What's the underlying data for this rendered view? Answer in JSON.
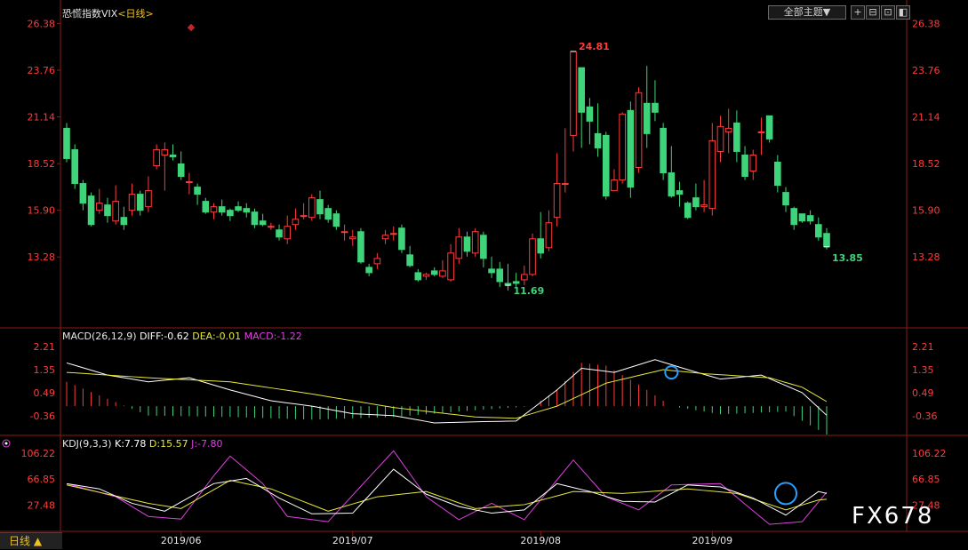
{
  "header": {
    "title": "恐慌指数VIX",
    "period": "<日线>",
    "theme_selector": "全部主题▼",
    "window_buttons": [
      "+",
      "⊟",
      "⊡",
      "◧",
      "⊠"
    ]
  },
  "bottom_tab": "日线 ▲",
  "watermark": "FX678",
  "colors": {
    "up": "#ff3b3b",
    "down": "#3fd37a",
    "axis_text": "#ff3b3b",
    "diff": "#ffffff",
    "dea": "#e8e83a",
    "macd": "#e040e0",
    "k": "#ffffff",
    "d": "#e8e83a",
    "j": "#e040e0",
    "highlight_circle": "#28a0ff"
  },
  "chart_data": [
    {
      "type": "candlestick",
      "title": "恐慌指数VIX",
      "y_ticks": [
        "26.38",
        "23.76",
        "21.14",
        "18.52",
        "15.90",
        "13.28"
      ],
      "ylim": [
        10.5,
        26.5
      ],
      "x_ticks": [
        "2019/06",
        "2019/07",
        "2019/08",
        "2019/09"
      ],
      "annotations": [
        {
          "label": "24.81",
          "value": 24.81
        },
        {
          "label": "11.69",
          "value": 11.69
        },
        {
          "label": "13.85",
          "value": 13.85
        }
      ],
      "candles": [
        [
          20.5,
          18.8,
          20.8,
          18.6
        ],
        [
          19.3,
          17.4,
          19.6,
          17.1
        ],
        [
          17.4,
          16.3,
          17.6,
          15.9
        ],
        [
          16.7,
          15.1,
          16.9,
          15.0
        ],
        [
          15.9,
          16.3,
          17.1,
          15.7
        ],
        [
          16.2,
          15.6,
          16.6,
          15.2
        ],
        [
          15.3,
          16.4,
          17.3,
          15.1
        ],
        [
          15.5,
          15.1,
          16.1,
          14.8
        ],
        [
          15.9,
          16.8,
          17.4,
          15.6
        ],
        [
          16.8,
          15.9,
          17.0,
          15.6
        ],
        [
          16.1,
          17.0,
          17.8,
          15.8
        ],
        [
          18.4,
          19.3,
          19.6,
          18.2
        ],
        [
          19.0,
          19.3,
          19.7,
          17.0
        ],
        [
          19.0,
          18.9,
          19.6,
          18.7
        ],
        [
          18.5,
          17.8,
          19.2,
          17.6
        ],
        [
          17.5,
          17.5,
          18.0,
          16.8
        ],
        [
          17.2,
          16.8,
          17.4,
          16.2
        ],
        [
          16.4,
          15.8,
          16.6,
          15.7
        ],
        [
          15.8,
          16.1,
          16.3,
          15.4
        ],
        [
          16.1,
          15.8,
          16.5,
          15.6
        ],
        [
          15.9,
          15.6,
          16.0,
          15.3
        ],
        [
          16.1,
          15.9,
          16.4,
          15.8
        ],
        [
          16.0,
          15.8,
          16.3,
          15.5
        ],
        [
          15.8,
          15.1,
          16.0,
          14.9
        ],
        [
          15.3,
          15.1,
          15.7,
          15.0
        ],
        [
          15.0,
          15.0,
          15.2,
          14.8
        ],
        [
          14.8,
          14.4,
          15.1,
          14.2
        ],
        [
          14.3,
          15.0,
          15.6,
          14.0
        ],
        [
          15.1,
          15.4,
          16.0,
          14.8
        ],
        [
          15.6,
          15.6,
          16.3,
          15.4
        ],
        [
          15.5,
          16.6,
          16.8,
          15.3
        ],
        [
          16.5,
          15.7,
          17.0,
          15.4
        ],
        [
          16.0,
          15.4,
          16.2,
          15.2
        ],
        [
          15.7,
          15.0,
          15.9,
          14.8
        ],
        [
          14.7,
          14.7,
          15.1,
          14.2
        ],
        [
          14.3,
          14.4,
          14.8,
          13.9
        ],
        [
          14.7,
          13.0,
          14.9,
          12.9
        ],
        [
          12.7,
          12.4,
          12.9,
          12.2
        ],
        [
          12.9,
          13.2,
          13.5,
          12.6
        ],
        [
          14.3,
          14.5,
          14.8,
          14.0
        ],
        [
          14.6,
          14.6,
          15.0,
          14.2
        ],
        [
          14.9,
          13.7,
          15.1,
          13.5
        ],
        [
          13.4,
          12.8,
          13.9,
          12.7
        ],
        [
          12.4,
          12.0,
          12.6,
          11.9
        ],
        [
          12.2,
          12.3,
          12.4,
          12.0
        ],
        [
          12.5,
          12.3,
          12.7,
          12.2
        ],
        [
          12.2,
          12.5,
          13.1,
          12.1
        ],
        [
          12.0,
          13.5,
          14.0,
          11.9
        ],
        [
          13.2,
          14.4,
          14.9,
          12.9
        ],
        [
          14.4,
          13.6,
          14.7,
          13.3
        ],
        [
          13.5,
          14.7,
          14.9,
          13.3
        ],
        [
          14.5,
          13.2,
          14.7,
          12.7
        ],
        [
          12.6,
          12.4,
          13.3,
          12.1
        ],
        [
          12.6,
          11.9,
          13.0,
          11.6
        ],
        [
          11.8,
          11.69,
          12.9,
          11.4
        ],
        [
          11.9,
          11.8,
          12.4,
          11.6
        ],
        [
          12.0,
          12.3,
          12.8,
          11.7
        ],
        [
          12.3,
          14.3,
          14.6,
          12.2
        ],
        [
          14.3,
          13.5,
          15.8,
          13.2
        ],
        [
          13.8,
          15.2,
          15.9,
          13.6
        ],
        [
          15.5,
          17.4,
          19.1,
          15.0
        ],
        [
          17.4,
          17.4,
          20.5,
          16.9
        ],
        [
          20.1,
          24.81,
          24.81,
          19.2
        ],
        [
          23.9,
          21.4,
          23.5,
          19.4
        ],
        [
          21.7,
          20.9,
          22.2,
          19.6
        ],
        [
          20.2,
          19.4,
          21.9,
          18.9
        ],
        [
          20.1,
          16.7,
          20.3,
          16.5
        ],
        [
          17.0,
          17.6,
          18.2,
          17.0
        ],
        [
          17.6,
          21.3,
          21.4,
          17.4
        ],
        [
          21.5,
          17.2,
          22.0,
          16.6
        ],
        [
          18.3,
          22.5,
          22.8,
          18.0
        ],
        [
          21.9,
          20.2,
          24.0,
          19.4
        ],
        [
          21.9,
          21.4,
          23.2,
          20.9
        ],
        [
          20.5,
          18.0,
          20.8,
          17.6
        ],
        [
          18.0,
          16.7,
          19.5,
          16.6
        ],
        [
          17.0,
          16.8,
          17.5,
          16.1
        ],
        [
          16.3,
          15.5,
          16.4,
          15.4
        ],
        [
          16.6,
          16.1,
          17.4,
          15.9
        ],
        [
          16.1,
          16.2,
          17.6,
          15.8
        ],
        [
          16.0,
          19.8,
          20.8,
          15.6
        ],
        [
          19.2,
          20.6,
          21.2,
          18.6
        ],
        [
          20.3,
          20.5,
          21.6,
          19.1
        ],
        [
          20.8,
          19.2,
          21.5,
          18.6
        ],
        [
          19.0,
          17.8,
          19.5,
          17.6
        ],
        [
          18.1,
          19.0,
          19.3,
          17.6
        ],
        [
          20.3,
          20.3,
          21.1,
          19.0
        ],
        [
          21.2,
          19.9,
          21.2,
          19.7
        ],
        [
          18.6,
          17.3,
          19.0,
          16.9
        ],
        [
          16.9,
          16.2,
          17.2,
          15.8
        ],
        [
          16.0,
          15.1,
          16.1,
          14.8
        ],
        [
          15.7,
          15.3,
          15.7,
          15.2
        ],
        [
          15.6,
          15.3,
          15.9,
          15.1
        ],
        [
          15.1,
          14.4,
          15.5,
          14.2
        ],
        [
          14.6,
          13.85,
          14.9,
          13.7
        ]
      ]
    },
    {
      "type": "macd",
      "title": "MACD(26,12,9)",
      "legend": {
        "diff": "DIFF:-0.62",
        "dea": "DEA:-0.01",
        "macd": "MACD:-1.22"
      },
      "y_ticks": [
        "2.21",
        "1.35",
        "0.49",
        "-0.36"
      ],
      "ylim": [
        -0.95,
        2.6
      ],
      "diff_key": [
        [
          0,
          1.6
        ],
        [
          5,
          1.15
        ],
        [
          10,
          0.9
        ],
        [
          15,
          1.05
        ],
        [
          20,
          0.6
        ],
        [
          25,
          0.2
        ],
        [
          30,
          0.0
        ],
        [
          35,
          -0.28
        ],
        [
          40,
          -0.35
        ],
        [
          45,
          -0.62
        ],
        [
          50,
          -0.58
        ],
        [
          55,
          -0.55
        ],
        [
          60,
          0.6
        ],
        [
          63,
          1.4
        ],
        [
          67,
          1.25
        ],
        [
          72,
          1.72
        ],
        [
          76,
          1.35
        ],
        [
          80,
          1.0
        ],
        [
          85,
          1.15
        ],
        [
          90,
          0.5
        ],
        [
          94,
          -0.62
        ]
      ],
      "dea_key": [
        [
          0,
          1.25
        ],
        [
          10,
          1.05
        ],
        [
          20,
          0.9
        ],
        [
          30,
          0.45
        ],
        [
          40,
          -0.05
        ],
        [
          50,
          -0.4
        ],
        [
          55,
          -0.45
        ],
        [
          60,
          0.0
        ],
        [
          66,
          0.85
        ],
        [
          73,
          1.35
        ],
        [
          78,
          1.2
        ],
        [
          86,
          1.05
        ],
        [
          90,
          0.7
        ],
        [
          94,
          -0.01
        ]
      ],
      "hist_key": [
        [
          0,
          0.9
        ],
        [
          10,
          -0.35
        ],
        [
          20,
          -0.4
        ],
        [
          30,
          -0.5
        ],
        [
          40,
          -0.4
        ],
        [
          50,
          -0.15
        ],
        [
          57,
          0.0
        ],
        [
          60,
          0.6
        ],
        [
          63,
          1.6
        ],
        [
          66,
          1.5
        ],
        [
          70,
          0.8
        ],
        [
          74,
          0.0
        ],
        [
          80,
          -0.3
        ],
        [
          88,
          -0.2
        ],
        [
          94,
          -1.22
        ]
      ]
    },
    {
      "type": "kdj",
      "title": "KDJ(9,3,3)",
      "legend": {
        "k": "K:7.78",
        "d": "D:15.57",
        "j": "J:-7.80"
      },
      "y_ticks": [
        "106.22",
        "66.85",
        "27.48"
      ],
      "ylim": [
        -10,
        120
      ],
      "k_key": [
        [
          0,
          60
        ],
        [
          4,
          52
        ],
        [
          8,
          30
        ],
        [
          12,
          18
        ],
        [
          18,
          60
        ],
        [
          22,
          68
        ],
        [
          26,
          38
        ],
        [
          30,
          14
        ],
        [
          35,
          15
        ],
        [
          40,
          82
        ],
        [
          44,
          44
        ],
        [
          48,
          25
        ],
        [
          52,
          15
        ],
        [
          56,
          20
        ],
        [
          60,
          60
        ],
        [
          64,
          48
        ],
        [
          68,
          33
        ],
        [
          72,
          32
        ],
        [
          76,
          58
        ],
        [
          80,
          55
        ],
        [
          84,
          38
        ],
        [
          88,
          12
        ],
        [
          92,
          48
        ],
        [
          94,
          42
        ],
        [
          98,
          30
        ],
        [
          100,
          8
        ]
      ],
      "d_key": [
        [
          0,
          58
        ],
        [
          10,
          30
        ],
        [
          14,
          22
        ],
        [
          20,
          65
        ],
        [
          25,
          52
        ],
        [
          32,
          18
        ],
        [
          38,
          40
        ],
        [
          44,
          48
        ],
        [
          50,
          22
        ],
        [
          56,
          28
        ],
        [
          62,
          48
        ],
        [
          68,
          45
        ],
        [
          76,
          52
        ],
        [
          82,
          45
        ],
        [
          88,
          20
        ],
        [
          92,
          35
        ],
        [
          96,
          40
        ],
        [
          100,
          15
        ]
      ],
      "j_key": [
        [
          0,
          60
        ],
        [
          6,
          40
        ],
        [
          10,
          10
        ],
        [
          14,
          6
        ],
        [
          18,
          72
        ],
        [
          20,
          102
        ],
        [
          24,
          60
        ],
        [
          27,
          10
        ],
        [
          32,
          2
        ],
        [
          40,
          110
        ],
        [
          44,
          40
        ],
        [
          48,
          5
        ],
        [
          52,
          30
        ],
        [
          56,
          5
        ],
        [
          62,
          96
        ],
        [
          66,
          40
        ],
        [
          70,
          20
        ],
        [
          74,
          58
        ],
        [
          80,
          60
        ],
        [
          86,
          -2
        ],
        [
          90,
          2
        ],
        [
          94,
          62
        ],
        [
          97,
          20
        ],
        [
          100,
          -8
        ]
      ]
    }
  ]
}
